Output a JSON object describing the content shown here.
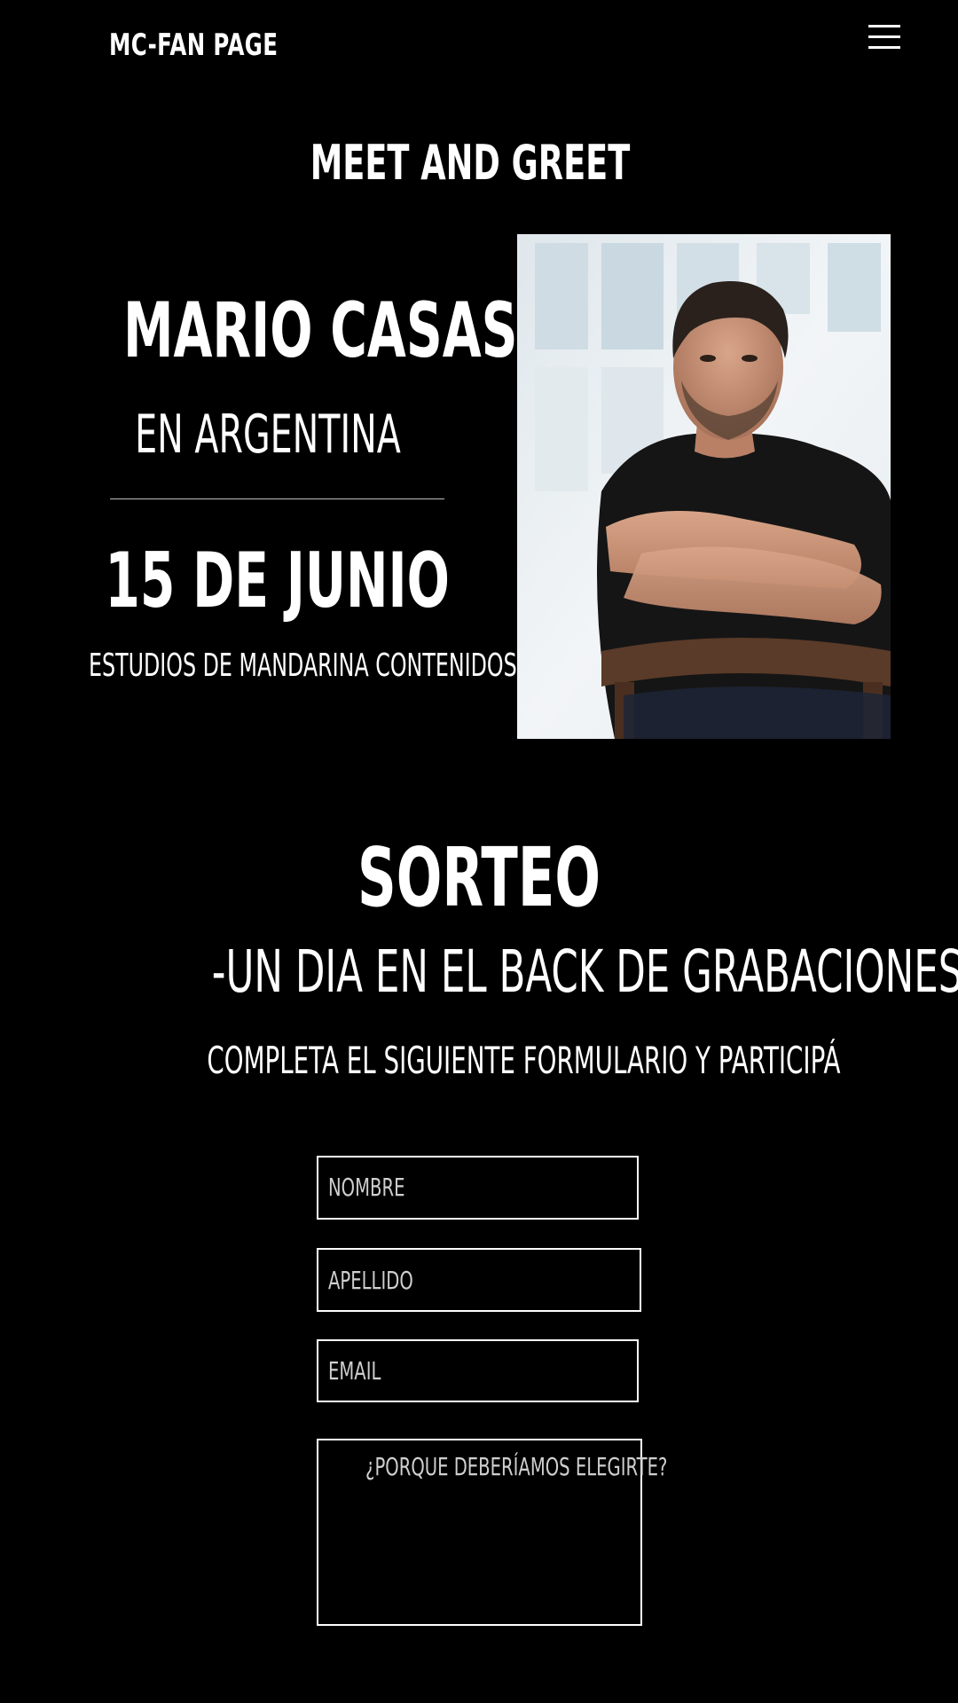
{
  "header": {
    "logo": "MC-FAN PAGE",
    "menu_icon": "hamburger-menu-icon"
  },
  "event": {
    "section_title": "MEET AND GREET",
    "name": "MARIO CASAS",
    "location": "EN ARGENTINA",
    "date": "15 DE JUNIO",
    "venue": "ESTUDIOS DE MANDARINA CONTENIDOS"
  },
  "giveaway": {
    "title": "SORTEO",
    "subtitle": "-UN DIA EN EL BACK DE GRABACIONES-",
    "instructions": "COMPLETA EL SIGUIENTE FORMULARIO Y PARTICIPÁ"
  },
  "form": {
    "nombre_placeholder": "NOMBRE",
    "apellido_placeholder": "APELLIDO",
    "email_placeholder": "EMAIL",
    "reason_placeholder": "¿PORQUE DEBERÍAMOS ELEGIRTE?"
  },
  "colors": {
    "background": "#000000",
    "text": "#ffffff",
    "placeholder": "#cfcfcf"
  }
}
